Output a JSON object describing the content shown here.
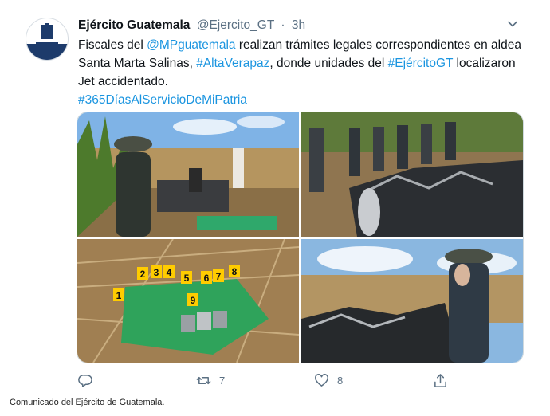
{
  "tweet": {
    "author_name": "Ejército Guatemala",
    "handle": "@Ejercito_GT",
    "separator": "·",
    "time": "3h",
    "text_parts": {
      "p1": "Fiscales del ",
      "mention": "@MPguatemala",
      "p2": " realizan trámites legales correspondientes en aldea Santa Marta Salinas, ",
      "hashtag1": "#AltaVerapaz",
      "p3": ", donde unidades del ",
      "hashtag2": "#EjércitoGT",
      "p4": " localizaron Jet accidentado.",
      "hashtag3": "#365DíasAlServicioDeMiPatria"
    },
    "retweet_count": "7",
    "like_count": "8",
    "link_color": "#1b95e0"
  },
  "evidence_markers": [
    "1",
    "2",
    "3",
    "4",
    "5",
    "6",
    "7",
    "8",
    "9"
  ],
  "icons": [
    "reply-icon",
    "retweet-icon",
    "like-icon",
    "share-icon",
    "chevron-down-icon"
  ],
  "caption": "Comunicado del Ejército de Guatemala."
}
